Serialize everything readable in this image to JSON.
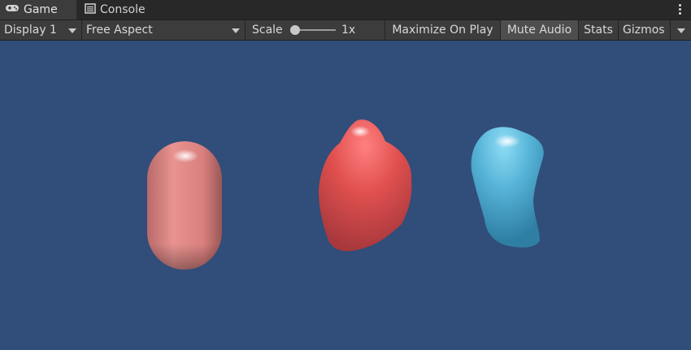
{
  "tabs": [
    {
      "label": "Game",
      "icon": "gamepad-icon",
      "active": true
    },
    {
      "label": "Console",
      "icon": "console-list-icon",
      "active": false
    }
  ],
  "toolbar": {
    "display": "Display 1",
    "aspect": "Free Aspect",
    "scale_label": "Scale",
    "scale_value": "1x",
    "scale_fraction": 0.0,
    "maximize_on_play": "Maximize On Play",
    "mute_audio": "Mute Audio",
    "mute_audio_on": true,
    "stats": "Stats",
    "gizmos": "Gizmos"
  },
  "viewport": {
    "background": "#314d79",
    "objects": [
      {
        "name": "capsule",
        "color": "#e8908e"
      },
      {
        "name": "red-blob",
        "color": "#e0504f"
      },
      {
        "name": "blue-blob",
        "color": "#56b4d8"
      }
    ]
  }
}
